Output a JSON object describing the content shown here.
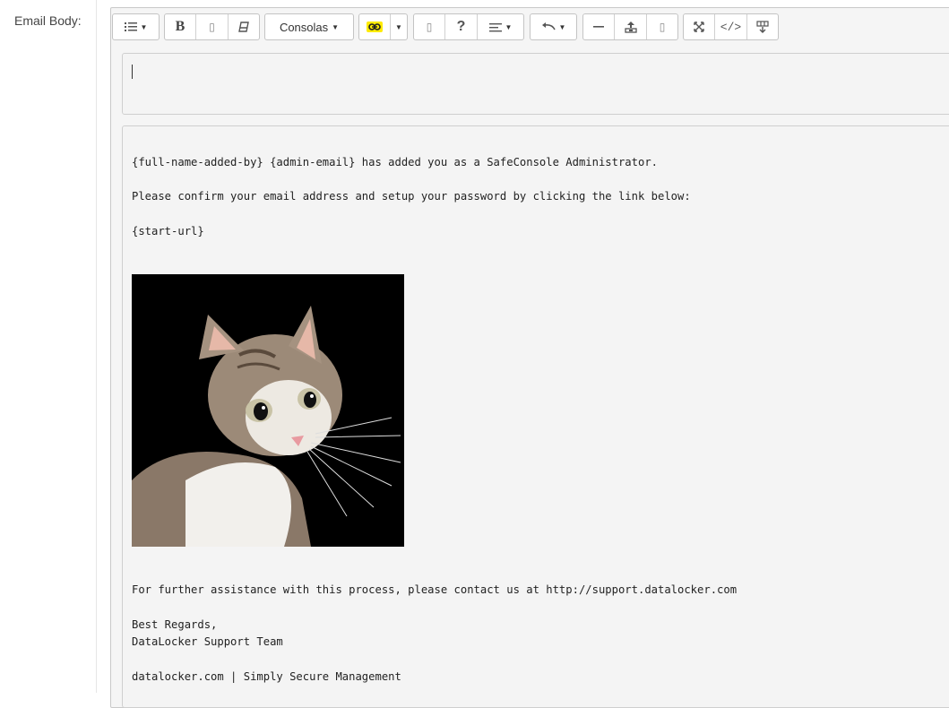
{
  "field": {
    "label": "Email Body:"
  },
  "toolbar": {
    "font_name": "Consolas",
    "bold_label": "B",
    "help_label": "?",
    "code_label": "</>",
    "icons": [
      "list-style-icon",
      "bold-icon",
      "italic-icon",
      "eraser-icon",
      "link-icon",
      "image-icon",
      "help-icon",
      "align-icon",
      "undo-icon",
      "horizontal-rule-icon",
      "upload-icon",
      "file-icon",
      "fullscreen-icon",
      "code-view-icon",
      "table-icon"
    ]
  },
  "email": {
    "line1": "{full-name-added-by} {admin-email} has added you as a SafeConsole Administrator.",
    "line2": "Please confirm your email address and setup your password by clicking the link below:",
    "line3": "{start-url}",
    "line4": "For further assistance with this process, please contact us at http://support.datalocker.com",
    "line5": "Best Regards,",
    "line6": "DataLocker Support Team",
    "line7": "datalocker.com | Simply Secure Management"
  },
  "colors": {
    "highlight": "#ffeb00",
    "editor_bg": "#f4f4f4",
    "border": "#c9c9c9"
  }
}
